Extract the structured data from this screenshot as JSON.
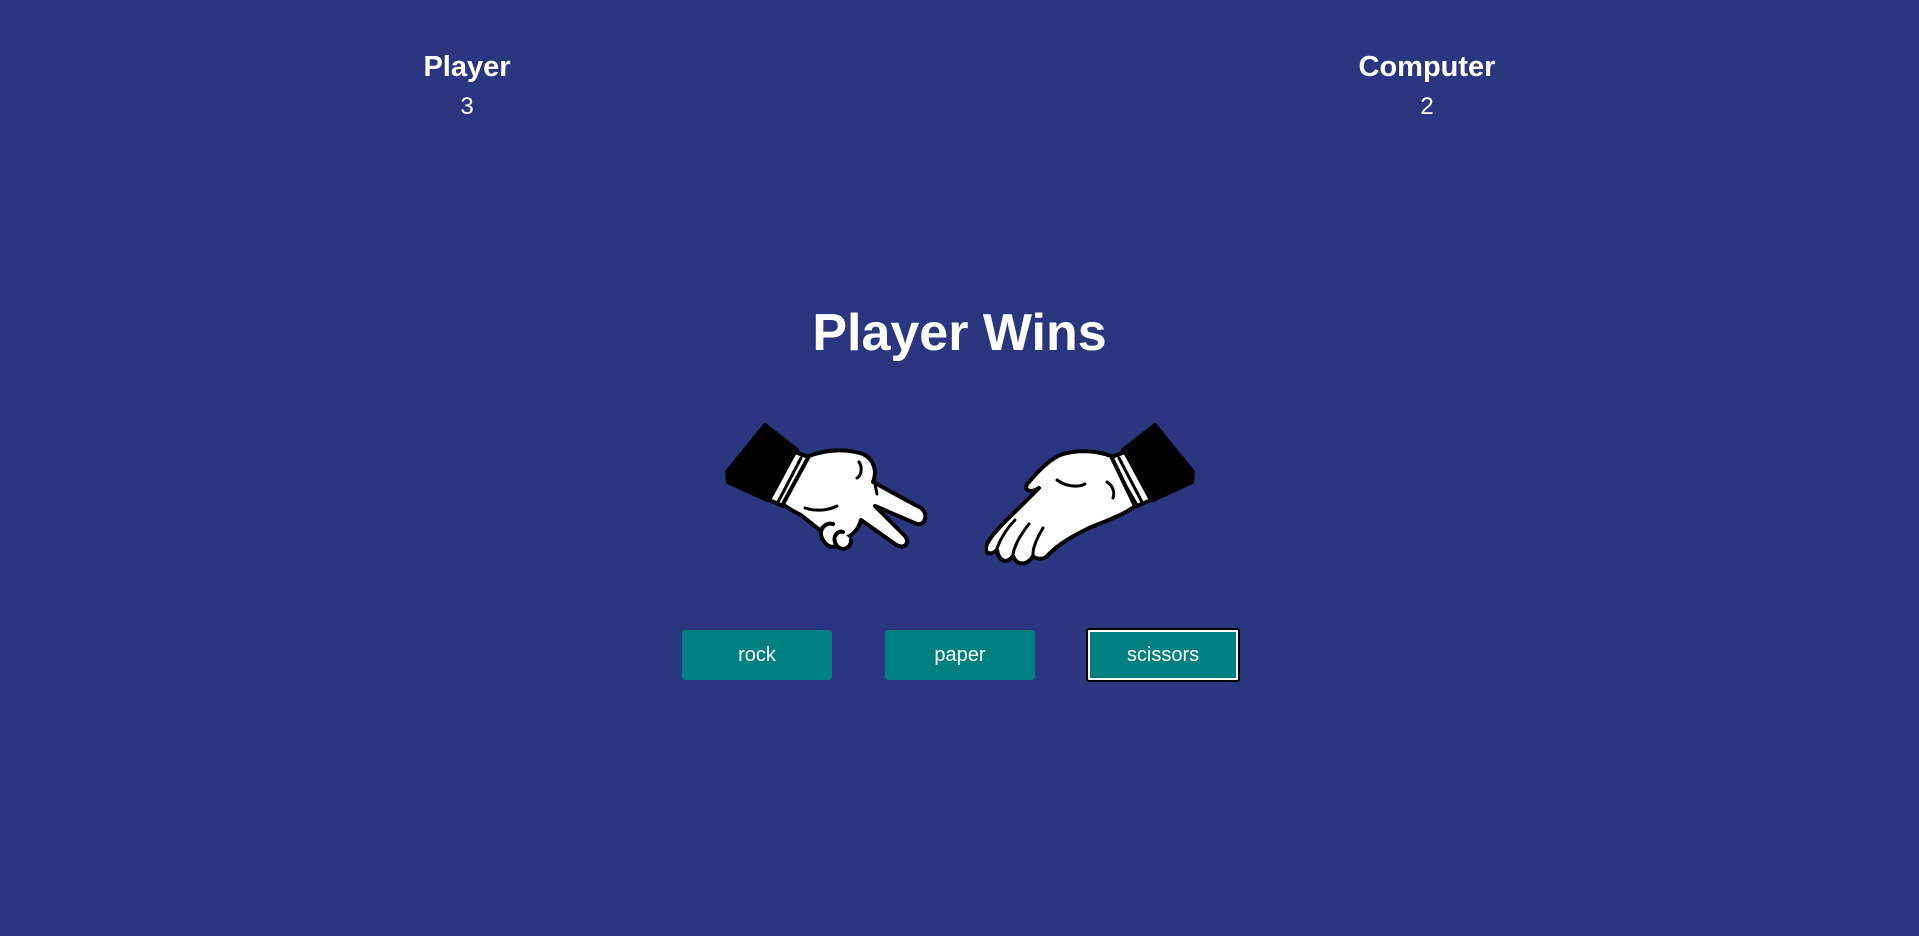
{
  "scoreboard": {
    "player": {
      "name": "Player",
      "score": "3"
    },
    "computer": {
      "name": "Computer",
      "score": "2"
    }
  },
  "result": "Player Wins",
  "hands": {
    "player_choice_icon": "scissors-hand-icon",
    "computer_choice_icon": "paper-hand-icon"
  },
  "buttons": {
    "rock": "rock",
    "paper": "paper",
    "scissors": "scissors",
    "focused": "scissors"
  },
  "colors": {
    "background": "#2a3780",
    "button": "#008080",
    "text": "#ffffff"
  }
}
